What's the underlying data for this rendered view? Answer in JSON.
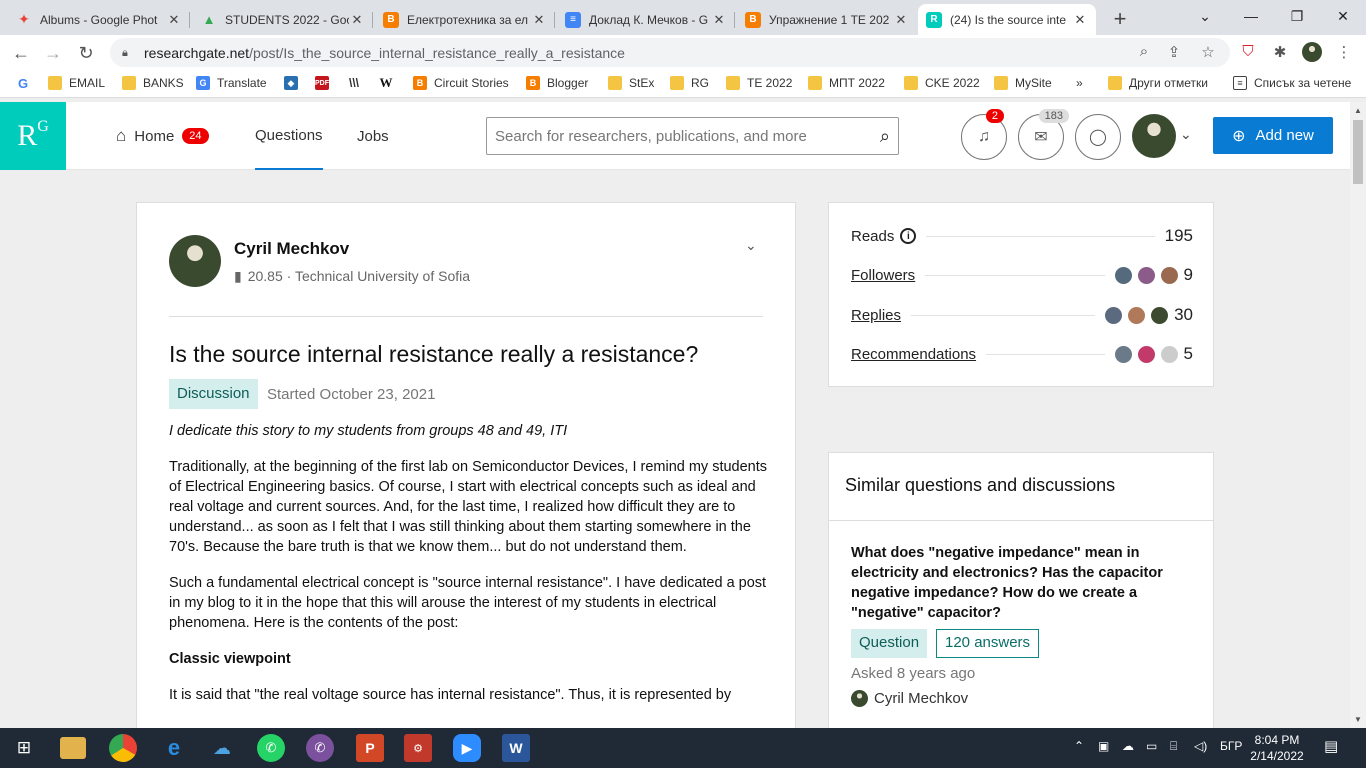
{
  "browser": {
    "tabs": [
      {
        "title": "Albums - Google Phot",
        "fav_color": "#fbbc05",
        "fav": "✦"
      },
      {
        "title": "STUDENTS 2022 - Goo",
        "fav_color": "#34a853",
        "fav": "▲"
      },
      {
        "title": "Електротехника за ел",
        "fav_color": "#f57d00",
        "fav": "B"
      },
      {
        "title": "Доклад К. Мечков - G",
        "fav_color": "#4285f4",
        "fav": "≡"
      },
      {
        "title": "Упражнение 1 ТЕ 202",
        "fav_color": "#f57d00",
        "fav": "B"
      },
      {
        "title": "(24) Is the source inte",
        "fav_color": "#00ccbb",
        "fav": "R"
      }
    ],
    "url_host": "researchgate.net",
    "url_path": "/post/Is_the_source_internal_resistance_really_a_resistance",
    "bookmarks": [
      {
        "label": "",
        "icon": "google"
      },
      {
        "label": "EMAIL",
        "icon": "folder"
      },
      {
        "label": "BANKS",
        "icon": "folder"
      },
      {
        "label": "Translate",
        "icon": "translate"
      },
      {
        "label": "",
        "icon": "cube"
      },
      {
        "label": "",
        "icon": "pdf"
      },
      {
        "label": "",
        "icon": "stacks"
      },
      {
        "label": "",
        "icon": "wiki"
      },
      {
        "label": "Circuit Stories",
        "icon": "blogger"
      },
      {
        "label": "Blogger",
        "icon": "blogger"
      },
      {
        "label": "StEx",
        "icon": "folder"
      },
      {
        "label": "RG",
        "icon": "folder"
      },
      {
        "label": "TE 2022",
        "icon": "folder"
      },
      {
        "label": "МПТ 2022",
        "icon": "folder"
      },
      {
        "label": "CKE 2022",
        "icon": "folder"
      },
      {
        "label": "MySite",
        "icon": "folder"
      },
      {
        "label": "»",
        "icon": "none"
      },
      {
        "label": "Други отметки",
        "icon": "folder"
      },
      {
        "label": "Списък за четене",
        "icon": "reading-list"
      }
    ]
  },
  "rg": {
    "logo": "R",
    "logo_sup": "G",
    "nav_home": "Home",
    "nav_home_badge": "24",
    "nav_questions": "Questions",
    "nav_jobs": "Jobs",
    "search_placeholder": "Search for researchers, publications, and more",
    "notif_badge": "2",
    "msg_badge": "183",
    "add_new": "Add new"
  },
  "post": {
    "author": "Cyril Mechkov",
    "author_meta": "20.85 · Technical University of Sofia",
    "title": "Is the source internal resistance really a resistance?",
    "tag": "Discussion",
    "started": "Started October 23, 2021",
    "dedication": "I dedicate this story to my students from groups 48 and 49, ITI",
    "para1": "Traditionally, at the beginning of the first lab on Semiconductor Devices, I remind my students of Electrical Engineering basics. Of course, I start with electrical concepts such as ideal and real voltage and current sources. And, for the last time, I realized how difficult they are to understand... as soon as I felt that I was still thinking about them starting somewhere in the 70's. Because the bare truth is that we know them... but do not understand them.",
    "para2": "Such a fundamental electrical concept is \"source internal resistance\". I have dedicated a post in my blog to it in the hope that this will arouse the interest of my students in electrical phenomena. Here is the contents of the post:",
    "heading": "Classic viewpoint",
    "para3": "It is said that \"the real voltage source has internal resistance\". Thus, it is represented by"
  },
  "stats": {
    "reads_label": "Reads",
    "reads": "195",
    "followers_label": "Followers",
    "followers": "9",
    "replies_label": "Replies",
    "replies": "30",
    "recs_label": "Recommendations",
    "recs": "5"
  },
  "similar": {
    "heading": "Similar questions and discussions",
    "question": "What does \"negative impedance\" mean in electricity and electronics? Has the capacitor negative impedance? How do we create a \"negative\" capacitor?",
    "tag": "Question",
    "answers": "120 answers",
    "asked": "Asked 8 years ago",
    "author": "Cyril Mechkov"
  },
  "taskbar": {
    "lang": "БГР",
    "time": "8:04 PM",
    "date": "2/14/2022"
  }
}
